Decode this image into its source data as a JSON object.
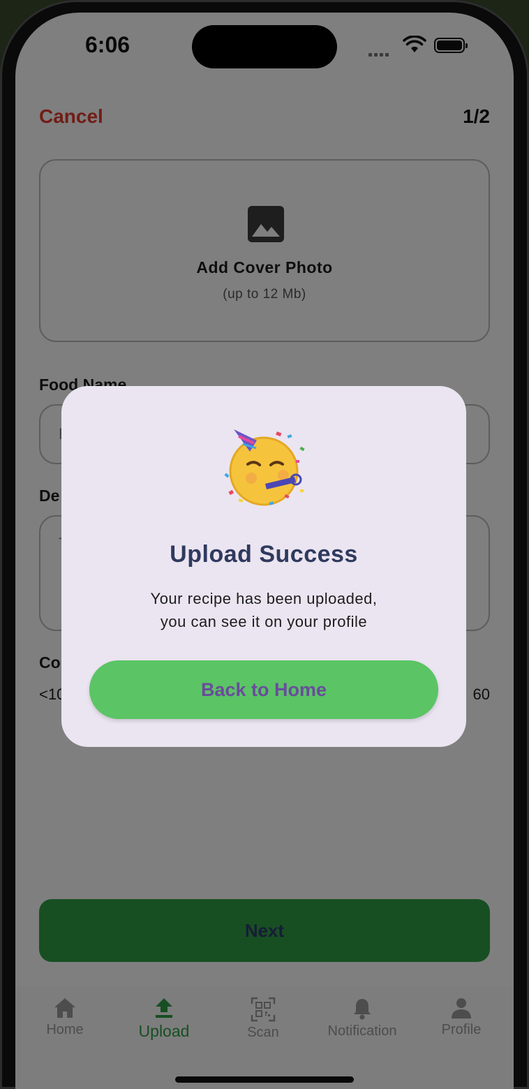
{
  "status_bar": {
    "time": "6:06"
  },
  "header": {
    "cancel_label": "Cancel",
    "step_label": "1/2"
  },
  "cover_photo": {
    "title": "Add Cover Photo",
    "subtitle": "(up to 12 Mb)"
  },
  "form": {
    "food_name_label": "Food Name",
    "food_name_visible_char": "E",
    "description_label_visible": "De",
    "description_visible_char": "T",
    "cooking_label_visible": "Co",
    "cooking_min_visible": "<10",
    "cooking_max_visible": "60"
  },
  "next_button": {
    "label": "Next"
  },
  "tab_bar": {
    "items": [
      {
        "label": "Home",
        "icon": "home-icon"
      },
      {
        "label": "Upload",
        "icon": "upload-icon",
        "active": true
      },
      {
        "label": "Scan",
        "icon": "qr-scan-icon"
      },
      {
        "label": "Notification",
        "icon": "bell-icon"
      },
      {
        "label": "Profile",
        "icon": "person-icon"
      }
    ]
  },
  "modal": {
    "emoji": "party-face-icon",
    "title": "Upload Success",
    "message_line1": "Your recipe has been uploaded,",
    "message_line2": "you can see it on your profile",
    "button_label": "Back to Home"
  },
  "colors": {
    "accent_green": "#2f9e44",
    "modal_button": "#5bc465",
    "cancel_red": "#e23b2e",
    "modal_bg": "#ebe5f1"
  }
}
